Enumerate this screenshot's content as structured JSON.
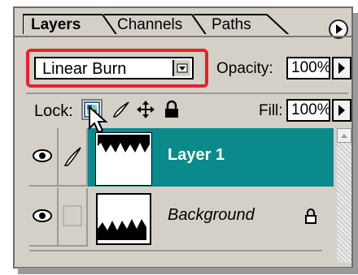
{
  "panel": {
    "tabs": [
      {
        "label": "Layers",
        "active": true
      },
      {
        "label": "Channels",
        "active": false
      },
      {
        "label": "Paths",
        "active": false
      }
    ],
    "blend_mode": "Linear Burn",
    "opacity_label": "Opacity:",
    "opacity_value": "100%",
    "lock_label": "Lock:",
    "fill_label": "Fill:",
    "fill_value": "100%"
  },
  "layers": [
    {
      "name": "Layer 1",
      "selected": true,
      "visible": true,
      "locked": false
    },
    {
      "name": "Background",
      "selected": false,
      "visible": true,
      "locked": true
    }
  ],
  "colors": {
    "selected_row": "#0a8a8a",
    "highlight": "#e0242c",
    "panel_bg": "#d4d0c8"
  }
}
